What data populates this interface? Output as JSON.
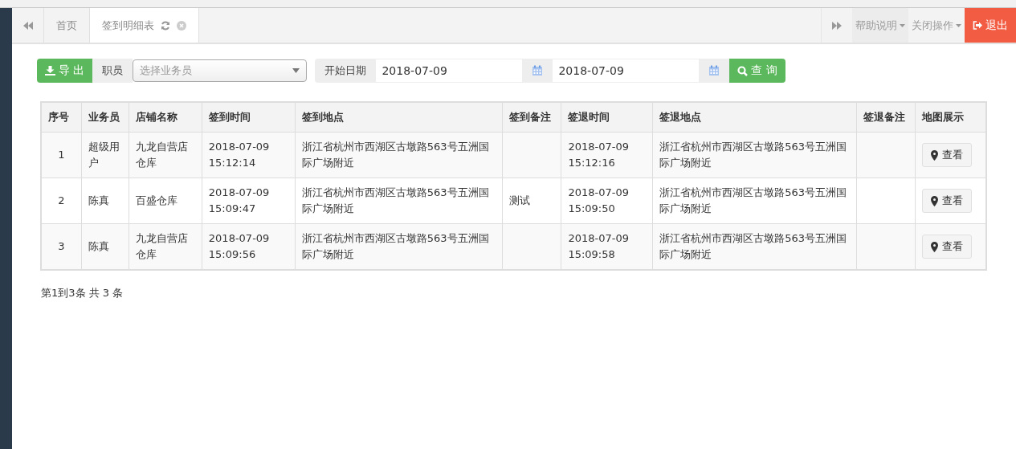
{
  "tabs": {
    "items": [
      {
        "label": "首页",
        "selected": false
      },
      {
        "label": "签到明细表",
        "selected": true
      }
    ],
    "help": "帮助说明",
    "close_ops": "关闭操作",
    "logout": "退出"
  },
  "toolbar": {
    "export": "导 出",
    "staff_label": "职员",
    "staff_placeholder": "选择业务员",
    "start_label": "开始日期",
    "start_date": "2018-07-09",
    "end_date": "2018-07-09",
    "query": "查 询"
  },
  "table": {
    "columns": [
      "序号",
      "业务员",
      "店铺名称",
      "签到时间",
      "签到地点",
      "签到备注",
      "签退时间",
      "签退地点",
      "签退备注",
      "地图展示"
    ],
    "rows": [
      {
        "no": "1",
        "staff": "超级用户",
        "store": "九龙自营店仓库",
        "in_time": "2018-07-09 15:12:14",
        "in_place": "浙江省杭州市西湖区古墩路563号五洲国际广场附近",
        "in_note": "",
        "out_time": "2018-07-09 15:12:16",
        "out_place": "浙江省杭州市西湖区古墩路563号五洲国际广场附近",
        "out_note": "",
        "action": "查看"
      },
      {
        "no": "2",
        "staff": "陈真",
        "store": "百盛仓库",
        "in_time": "2018-07-09 15:09:47",
        "in_place": "浙江省杭州市西湖区古墩路563号五洲国际广场附近",
        "in_note": "测试",
        "out_time": "2018-07-09 15:09:50",
        "out_place": "浙江省杭州市西湖区古墩路563号五洲国际广场附近",
        "out_note": "",
        "action": "查看"
      },
      {
        "no": "3",
        "staff": "陈真",
        "store": "九龙自营店仓库",
        "in_time": "2018-07-09 15:09:56",
        "in_place": "浙江省杭州市西湖区古墩路563号五洲国际广场附近",
        "in_note": "",
        "out_time": "2018-07-09 15:09:58",
        "out_place": "浙江省杭州市西湖区古墩路563号五洲国际广场附近",
        "out_note": "",
        "action": "查看"
      }
    ]
  },
  "pagination": "第1到3条 共 3 条"
}
